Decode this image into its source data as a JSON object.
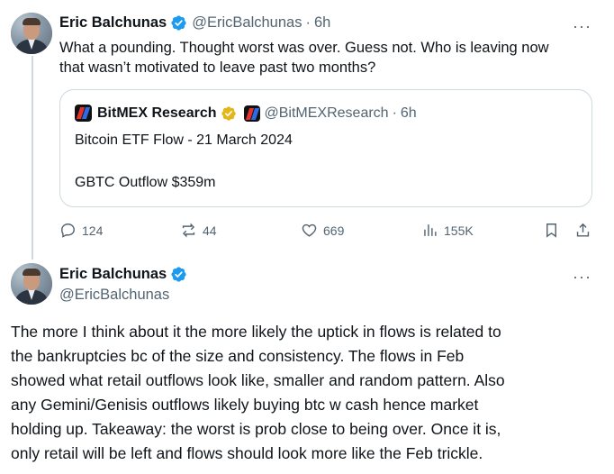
{
  "tweet1": {
    "name": "Eric Balchunas",
    "handle": "@EricBalchunas",
    "separator": "·",
    "time": "6h",
    "text_line1": "What a pounding. Thought worst was over. Guess not. Who is leaving now",
    "text_line2": "that wasn’t motivated to leave past two months?",
    "quote": {
      "name": "BitMEX Research",
      "handle": "@BitMEXResearch",
      "separator": "·",
      "time": "6h",
      "line1": "Bitcoin ETF Flow - 21 March 2024",
      "line2": "GBTC Outflow $359m"
    },
    "actions": {
      "replies": "124",
      "reposts": "44",
      "likes": "669",
      "views": "155K"
    }
  },
  "tweet2": {
    "name": "Eric Balchunas",
    "handle": "@EricBalchunas",
    "lines": [
      "The more I think about it the more likely the uptick in flows is related to",
      "the bankruptcies bc of the size and consistency. The flows in Feb",
      "showed what retail outflows look like, smaller and random pattern. Also",
      "any Gemini/Genisis outflows likely buying btc w cash hence market",
      "holding up. Takeaway: the worst is prob close to being over. Once it is,",
      "only retail will be left and flows should look more like the Feb trickle."
    ]
  },
  "more_glyph": "···",
  "icons": {
    "verified": "verified-badge-icon",
    "gold": "gold-verified-badge-icon",
    "reply": "reply-icon",
    "repost": "repost-icon",
    "like": "heart-icon",
    "views": "views-icon",
    "bookmark": "bookmark-icon",
    "share": "share-icon",
    "more": "more-icon"
  },
  "colors": {
    "verified_blue": "#1d9bf0",
    "gold_badge": "#e2b719",
    "muted": "#536471",
    "border": "#cfd9de"
  }
}
